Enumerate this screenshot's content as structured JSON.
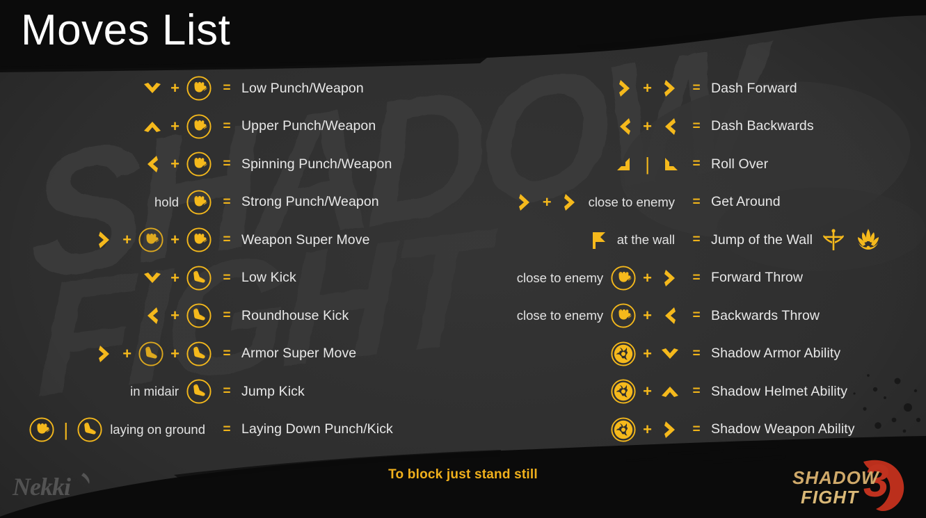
{
  "header": {
    "title": "Moves List"
  },
  "footer": {
    "block_hint": "To block just stand still",
    "publisher_logo": "nekki-logo",
    "game_logo_line1": "SHADOW",
    "game_logo_line2": "FIGHT",
    "game_logo_number": "3"
  },
  "colors": {
    "accent": "#f5b91c",
    "accent_dark": "#c99412",
    "background": "#2e2e2e",
    "band": "#0b0b0b",
    "label_text": "#e8e8e8",
    "hint_text": "#f0b01c",
    "title_text": "#ffffff",
    "logo_red": "#c0321f",
    "logo_tan": "#cfa96a"
  },
  "symbols": {
    "plus": "+",
    "equals": "=",
    "pipe": "|"
  },
  "left_column": [
    {
      "inputs": [
        {
          "type": "arrow",
          "dir": "down",
          "name": "arrow-down-icon"
        },
        {
          "type": "plus"
        },
        {
          "type": "icon",
          "icon": "punch-icon"
        }
      ],
      "label": "Low Punch/Weapon"
    },
    {
      "inputs": [
        {
          "type": "arrow",
          "dir": "up",
          "name": "arrow-up-icon"
        },
        {
          "type": "plus"
        },
        {
          "type": "icon",
          "icon": "punch-icon"
        }
      ],
      "label": "Upper Punch/Weapon"
    },
    {
      "inputs": [
        {
          "type": "arrow",
          "dir": "left",
          "name": "arrow-left-icon"
        },
        {
          "type": "plus"
        },
        {
          "type": "icon",
          "icon": "punch-icon"
        }
      ],
      "label": "Spinning Punch/Weapon"
    },
    {
      "inputs": [
        {
          "type": "note",
          "text": "hold"
        },
        {
          "type": "icon",
          "icon": "punch-icon"
        }
      ],
      "label": "Strong Punch/Weapon"
    },
    {
      "inputs": [
        {
          "type": "arrow",
          "dir": "right",
          "name": "arrow-right-icon"
        },
        {
          "type": "plus"
        },
        {
          "type": "icon",
          "icon": "punch-icon",
          "dim": true
        },
        {
          "type": "plus"
        },
        {
          "type": "icon",
          "icon": "punch-icon"
        }
      ],
      "label": "Weapon Super Move"
    },
    {
      "inputs": [
        {
          "type": "arrow",
          "dir": "down",
          "name": "arrow-down-icon"
        },
        {
          "type": "plus"
        },
        {
          "type": "icon",
          "icon": "kick-icon"
        }
      ],
      "label": "Low Kick"
    },
    {
      "inputs": [
        {
          "type": "arrow",
          "dir": "left",
          "name": "arrow-left-icon"
        },
        {
          "type": "plus"
        },
        {
          "type": "icon",
          "icon": "kick-icon"
        }
      ],
      "label": "Roundhouse Kick"
    },
    {
      "inputs": [
        {
          "type": "arrow",
          "dir": "right",
          "name": "arrow-right-icon"
        },
        {
          "type": "plus"
        },
        {
          "type": "icon",
          "icon": "kick-icon",
          "dim": true
        },
        {
          "type": "plus"
        },
        {
          "type": "icon",
          "icon": "kick-icon"
        }
      ],
      "label": "Armor Super Move"
    },
    {
      "inputs": [
        {
          "type": "note",
          "text": "in midair"
        },
        {
          "type": "icon",
          "icon": "kick-icon"
        }
      ],
      "label": "Jump Kick"
    },
    {
      "inputs": [
        {
          "type": "icon",
          "icon": "punch-icon"
        },
        {
          "type": "pipe"
        },
        {
          "type": "icon",
          "icon": "kick-icon"
        },
        {
          "type": "note",
          "text": "laying on ground"
        }
      ],
      "label": "Laying Down Punch/Kick"
    }
  ],
  "right_column": [
    {
      "inputs": [
        {
          "type": "arrow",
          "dir": "right",
          "name": "arrow-right-icon"
        },
        {
          "type": "plus"
        },
        {
          "type": "arrow",
          "dir": "right",
          "name": "arrow-right-icon"
        }
      ],
      "label": "Dash Forward"
    },
    {
      "inputs": [
        {
          "type": "arrow",
          "dir": "left",
          "name": "arrow-left-icon"
        },
        {
          "type": "plus"
        },
        {
          "type": "arrow",
          "dir": "left",
          "name": "arrow-left-icon"
        }
      ],
      "label": "Dash Backwards"
    },
    {
      "inputs": [
        {
          "type": "arrow",
          "dir": "downleft",
          "name": "arrow-down-left-icon"
        },
        {
          "type": "pipe"
        },
        {
          "type": "arrow",
          "dir": "downright",
          "name": "arrow-down-right-icon"
        }
      ],
      "label": "Roll Over"
    },
    {
      "inputs": [
        {
          "type": "arrow",
          "dir": "right",
          "name": "arrow-right-icon"
        },
        {
          "type": "plus"
        },
        {
          "type": "arrow",
          "dir": "right",
          "name": "arrow-right-icon"
        },
        {
          "type": "note",
          "text": "close to enemy"
        }
      ],
      "label": "Get Around"
    },
    {
      "inputs": [
        {
          "type": "arrow",
          "dir": "flag",
          "name": "wall-flag-icon"
        },
        {
          "type": "note",
          "text": "at the wall"
        }
      ],
      "label": "Jump of the Wall",
      "factions": [
        "legion-emblem-icon",
        "dynasty-emblem-icon"
      ]
    },
    {
      "inputs": [
        {
          "type": "note",
          "text": "close to enemy"
        },
        {
          "type": "icon",
          "icon": "punch-icon"
        },
        {
          "type": "plus"
        },
        {
          "type": "arrow",
          "dir": "right",
          "name": "arrow-right-icon"
        }
      ],
      "label": "Forward Throw"
    },
    {
      "inputs": [
        {
          "type": "note",
          "text": "close to enemy"
        },
        {
          "type": "icon",
          "icon": "punch-icon"
        },
        {
          "type": "plus"
        },
        {
          "type": "arrow",
          "dir": "left",
          "name": "arrow-left-icon"
        }
      ],
      "label": "Backwards Throw"
    },
    {
      "inputs": [
        {
          "type": "icon",
          "icon": "shadow-icon"
        },
        {
          "type": "plus"
        },
        {
          "type": "arrow",
          "dir": "down",
          "name": "arrow-down-icon"
        }
      ],
      "label": "Shadow Armor Ability"
    },
    {
      "inputs": [
        {
          "type": "icon",
          "icon": "shadow-icon"
        },
        {
          "type": "plus"
        },
        {
          "type": "arrow",
          "dir": "up",
          "name": "arrow-up-icon"
        }
      ],
      "label": "Shadow Helmet Ability"
    },
    {
      "inputs": [
        {
          "type": "icon",
          "icon": "shadow-icon"
        },
        {
          "type": "plus"
        },
        {
          "type": "arrow",
          "dir": "right",
          "name": "arrow-right-icon"
        }
      ],
      "label": "Shadow Weapon Ability"
    }
  ],
  "background": {
    "watermark_text": "SHADOW FIGHT"
  }
}
